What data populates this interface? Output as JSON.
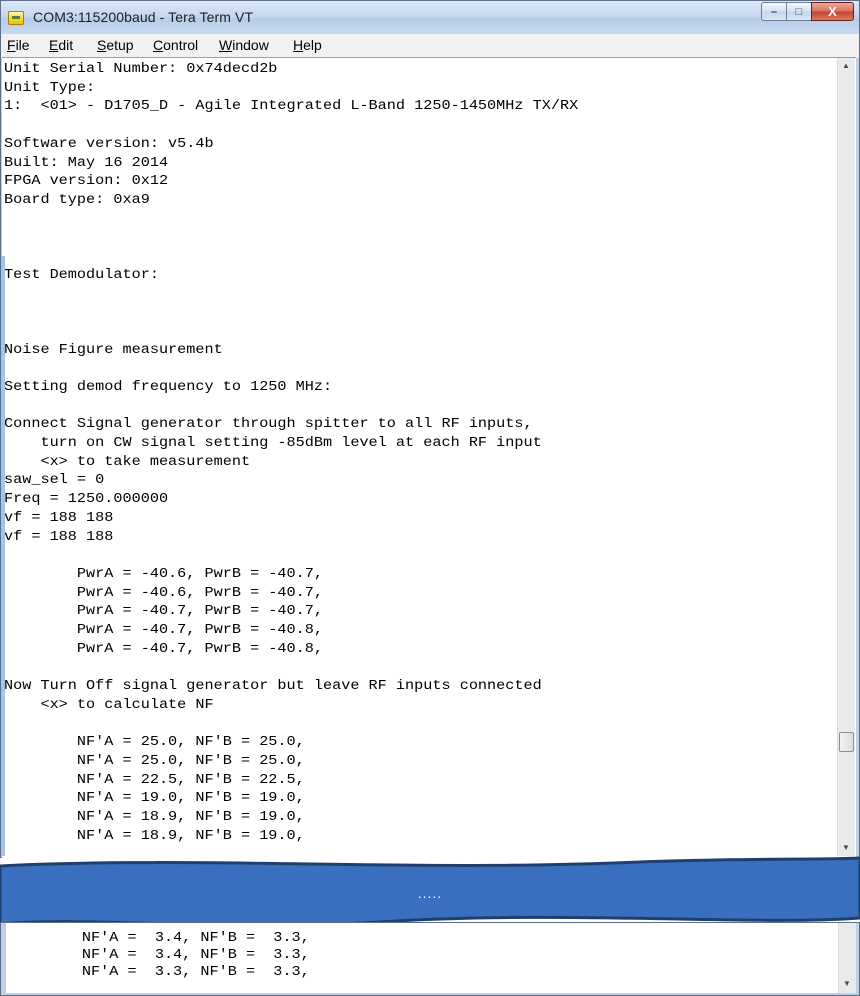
{
  "window": {
    "title": "COM3:115200baud - Tera Term VT",
    "controls": {
      "minimize": "–",
      "maximize": "□",
      "close": "X"
    }
  },
  "menu": [
    {
      "label": "File",
      "accel": "F",
      "rest": "ile"
    },
    {
      "label": "Edit",
      "accel": "E",
      "rest": "dit"
    },
    {
      "label": "Setup",
      "accel": "S",
      "rest": "etup"
    },
    {
      "label": "Control",
      "accel": "C",
      "rest": "ontrol"
    },
    {
      "label": "Window",
      "accel": "W",
      "rest": "indow"
    },
    {
      "label": "Help",
      "accel": "H",
      "rest": "elp"
    }
  ],
  "terminal": {
    "lines": [
      "Unit Serial Number: 0x74decd2b",
      "Unit Type:",
      "1:  <01> - D1705_D - Agile Integrated L-Band 1250-1450MHz TX/RX",
      "",
      "Software version: v5.4b",
      "Built: May 16 2014",
      "FPGA version: 0x12",
      "Board type: 0xa9",
      "",
      "",
      "",
      "Test Demodulator:",
      "",
      "",
      "",
      "Noise Figure measurement",
      "",
      "Setting demod frequency to 1250 MHz:",
      "",
      "Connect Signal generator through spitter to all RF inputs,",
      "    turn on CW signal setting -85dBm level at each RF input",
      "    <x> to take measurement",
      "saw_sel = 0",
      "Freq = 1250.000000",
      "vf = 188 188",
      "vf = 188 188",
      "",
      "        PwrA = -40.6, PwrB = -40.7,",
      "        PwrA = -40.6, PwrB = -40.7,",
      "        PwrA = -40.7, PwrB = -40.7,",
      "        PwrA = -40.7, PwrB = -40.8,",
      "        PwrA = -40.7, PwrB = -40.8,",
      "",
      "Now Turn Off signal generator but leave RF inputs connected",
      "    <x> to calculate NF",
      "",
      "        NF'A = 25.0, NF'B = 25.0,",
      "        NF'A = 25.0, NF'B = 25.0,",
      "        NF'A = 22.5, NF'B = 22.5,",
      "        NF'A = 19.0, NF'B = 19.0,",
      "        NF'A = 18.9, NF'B = 19.0,",
      "        NF'A = 18.9, NF'B = 19.0,"
    ],
    "tail_lines": [
      "        NF'A =  3.4, NF'B =  3.3,",
      "        NF'A =  3.4, NF'B =  3.3,",
      "        NF'A =  3.3, NF'B =  3.3,"
    ]
  },
  "break_label": ".....",
  "colors": {
    "banner": "#3a6fbf",
    "banner_border": "#1f3f6e",
    "frame": "#bcd1ea"
  }
}
